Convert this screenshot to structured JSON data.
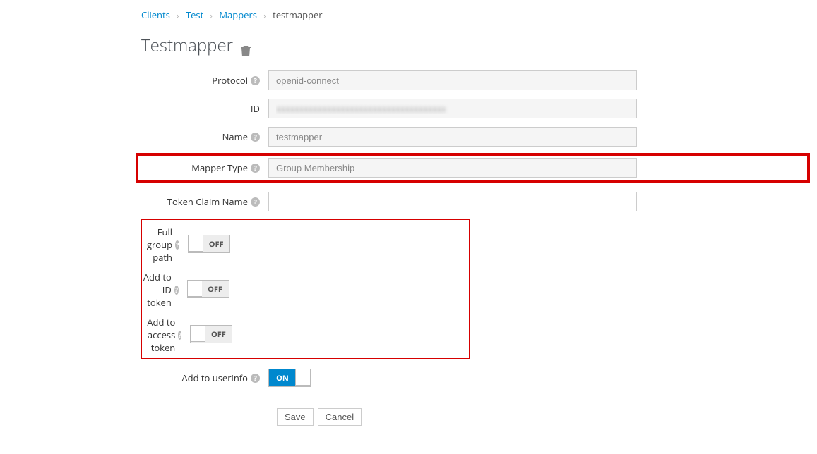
{
  "breadcrumb": {
    "items": [
      "Clients",
      "Test",
      "Mappers"
    ],
    "current": "testmapper"
  },
  "title": "Testmapper",
  "fields": {
    "protocol": {
      "label": "Protocol",
      "value": "openid-connect"
    },
    "id": {
      "label": "ID",
      "value": ""
    },
    "name": {
      "label": "Name",
      "value": "testmapper"
    },
    "mapper_type": {
      "label": "Mapper Type",
      "value": "Group Membership"
    },
    "token_claim": {
      "label": "Token Claim Name",
      "value": ""
    },
    "full_group_path": {
      "label": "Full group path",
      "on": false
    },
    "add_id_token": {
      "label": "Add to ID token",
      "on": false
    },
    "add_access_token": {
      "label": "Add to access token",
      "on": false
    },
    "add_userinfo": {
      "label": "Add to userinfo",
      "on": true
    }
  },
  "toggle_labels": {
    "on": "ON",
    "off": "OFF"
  },
  "buttons": {
    "save": "Save",
    "cancel": "Cancel"
  }
}
